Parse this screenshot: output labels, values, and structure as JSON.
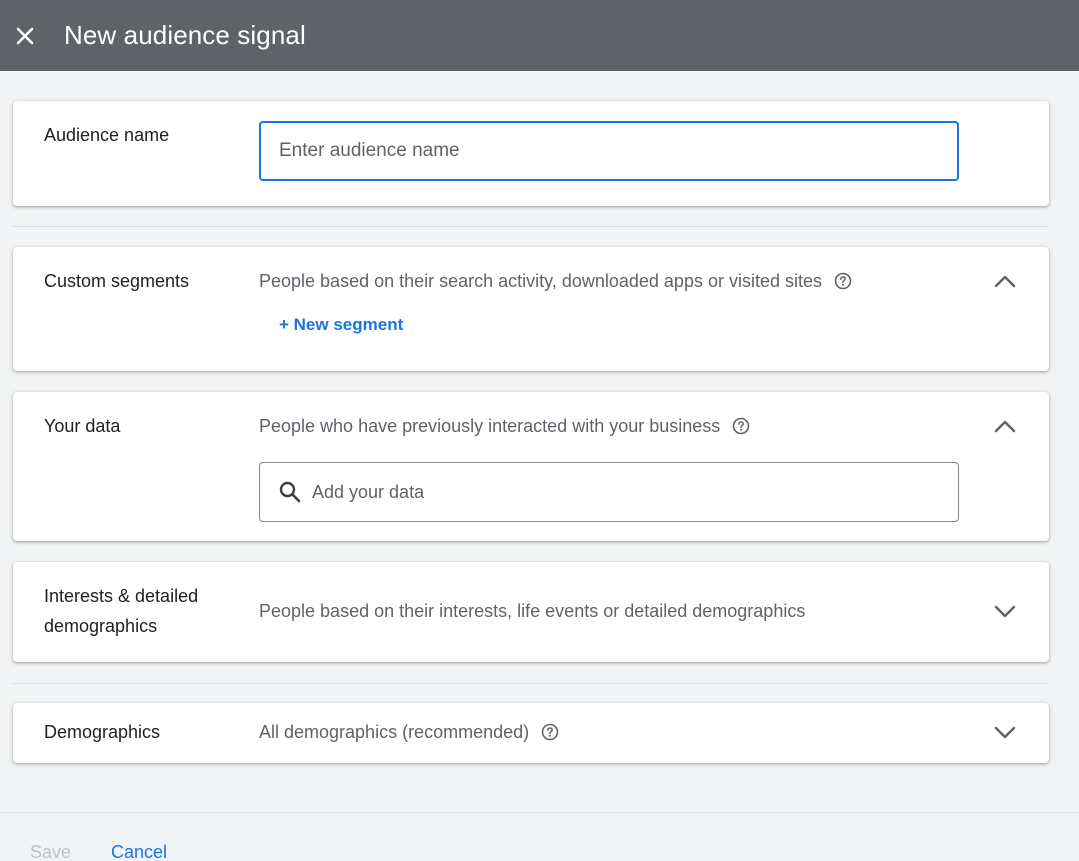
{
  "header": {
    "title": "New audience signal",
    "close_icon": "close-icon"
  },
  "audience_name": {
    "label": "Audience name",
    "value": "",
    "placeholder": "Enter audience name"
  },
  "custom_segments": {
    "label": "Custom segments",
    "description": "People based on their search activity, downloaded apps or visited sites",
    "new_segment_label": "+ New segment",
    "expanded": true
  },
  "your_data": {
    "label": "Your data",
    "description": "People who have previously interacted with your business",
    "search_placeholder": "Add your data",
    "expanded": true
  },
  "interests": {
    "label_line1": "Interests & detailed",
    "label_line2": "demographics",
    "description": "People based on their interests, life events or detailed demographics",
    "expanded": false
  },
  "demographics": {
    "label": "Demographics",
    "description": "All demographics (recommended)",
    "expanded": false
  },
  "footer": {
    "save_label": "Save",
    "cancel_label": "Cancel"
  },
  "colors": {
    "header_bg": "#5f6368",
    "accent": "#1a73e8",
    "page_bg": "#f1f3f4",
    "disabled_text": "#bdc1c6"
  }
}
